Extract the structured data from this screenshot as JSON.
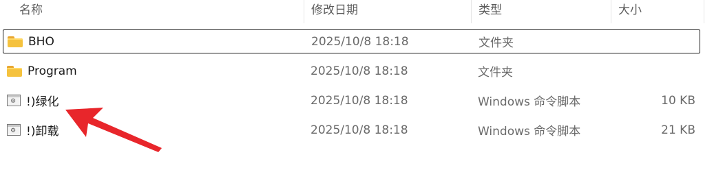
{
  "columns": {
    "name": "名称",
    "modified": "修改日期",
    "type": "类型",
    "size": "大小"
  },
  "rows": [
    {
      "name": "BHO",
      "modified": "2025/10/8 18:18",
      "type": "文件夹",
      "size": "",
      "icon": "folder-icon",
      "selected": true
    },
    {
      "name": "Program",
      "modified": "2025/10/8 18:18",
      "type": "文件夹",
      "size": "",
      "icon": "folder-icon",
      "selected": false
    },
    {
      "name": "!)绿化",
      "modified": "2025/10/8 18:18",
      "type": "Windows 命令脚本",
      "size": "10 KB",
      "icon": "script-icon",
      "selected": false
    },
    {
      "name": "!)卸载",
      "modified": "2025/10/8 18:18",
      "type": "Windows 命令脚本",
      "size": "21 KB",
      "icon": "script-icon",
      "selected": false
    }
  ],
  "annotation": {
    "arrow_color": "#e8262b",
    "points_to": "!)绿化"
  }
}
